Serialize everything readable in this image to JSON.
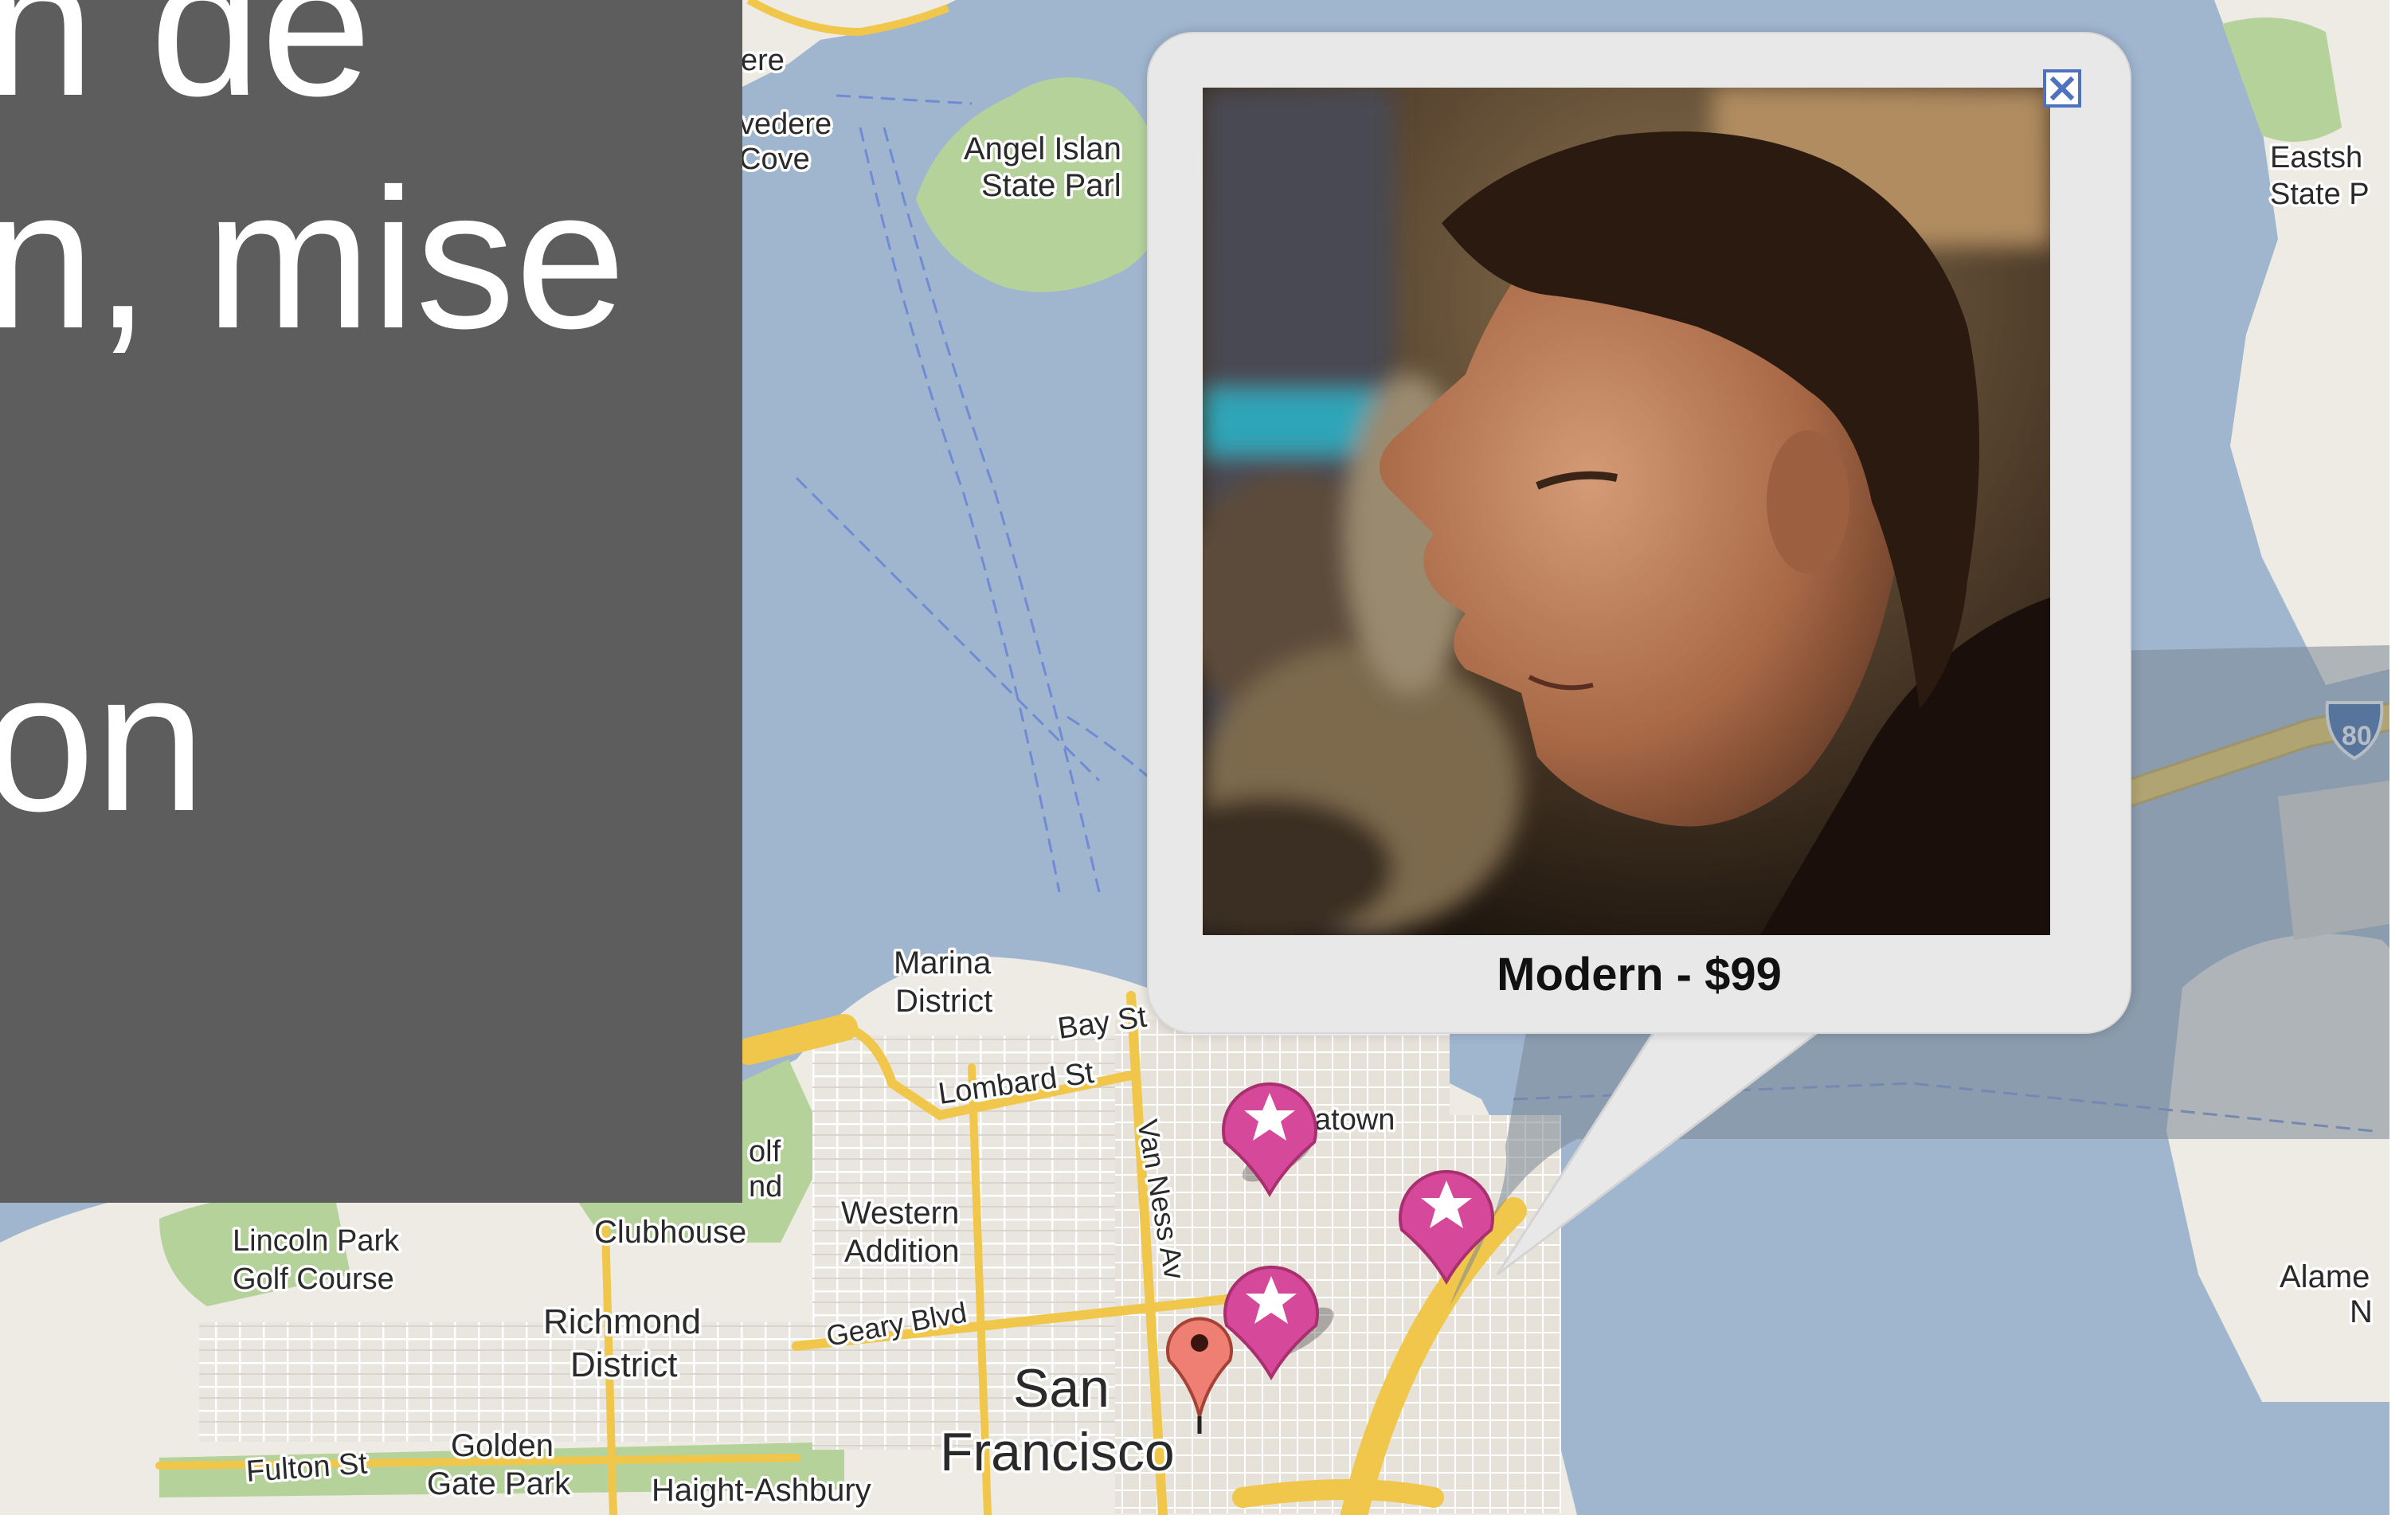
{
  "slide": {
    "lines": [
      "n de",
      "n, mise",
      "",
      "on"
    ]
  },
  "popup": {
    "caption": "Modern - $99",
    "close_icon": "close-icon"
  },
  "map": {
    "labels": {
      "tiburon_fragment": "ere",
      "belvedere_line1": "vedere",
      "belvedere_line2": "Cove",
      "angel_island_line1": "Angel Islan",
      "angel_island_line2": "State Parl",
      "eastshore_line1": "Eastsh",
      "eastshore_line2": "State P",
      "marina_line1": "Marina",
      "marina_line2": "District",
      "bay_st": "Bay St",
      "lombard_st": "Lombard St",
      "chinatown_fragment": "atown",
      "golf_fragment_1": "olf",
      "golf_fragment_2": "nd",
      "van_ness": "Van Ness Av",
      "western_addition_line1": "Western",
      "western_addition_line2": "Addition",
      "clubhouse": "Clubhouse",
      "lincoln_park_line1": "Lincoln Park",
      "lincoln_park_line2": "Golf Course",
      "richmond_line1": "Richmond",
      "richmond_line2": "District",
      "geary_blvd": "Geary Blvd",
      "san_francisco_line1": "San",
      "san_francisco_line2": "Francisco",
      "golden_gate_line1": "Golden",
      "golden_gate_line2": "Gate Park",
      "fulton_st": "Fulton St",
      "haight_ashbury": "Haight-Ashbury",
      "alameda_line1": "Alame",
      "alameda_line2": "N",
      "interstate": "80"
    },
    "colors": {
      "water": "#a0b6cf",
      "land": "#eeebe4",
      "park": "#b5d29b",
      "major_road": "#f0c74b",
      "minor_road": "#ffffff",
      "marker_pink": "#d6489a"
    }
  }
}
